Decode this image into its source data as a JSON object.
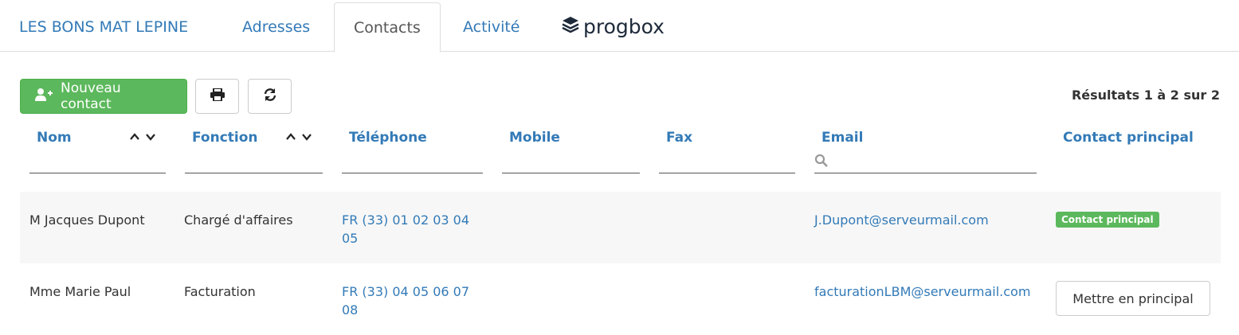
{
  "tabs": {
    "company": "LES BONS MAT LEPINE",
    "addresses": "Adresses",
    "contacts": "Contacts",
    "activity": "Activité"
  },
  "logo": {
    "text": "progbox"
  },
  "toolbar": {
    "new_contact_label": "Nouveau contact",
    "results_text": "Résultats 1 à 2 sur 2"
  },
  "columns": {
    "name": "Nom",
    "function": "Fonction",
    "phone": "Téléphone",
    "mobile": "Mobile",
    "fax": "Fax",
    "email": "Email",
    "primary": "Contact principal"
  },
  "filters": {
    "name": "",
    "function": "",
    "phone": "",
    "mobile": "",
    "fax": "",
    "email": ""
  },
  "rows": [
    {
      "name": "M Jacques Dupont",
      "function": "Chargé d'affaires",
      "phone": "FR (33) 01 02 03 04 05",
      "mobile": "",
      "fax": "",
      "email": "J.Dupont@serveurmail.com",
      "primary_badge": "Contact principal"
    },
    {
      "name": "Mme Marie Paul",
      "function": "Facturation",
      "phone": "FR (33) 04 05 06 07 08",
      "mobile": "",
      "fax": "",
      "email": "facturationLBM@serveurmail.com",
      "primary_button": "Mettre en principal"
    }
  ],
  "colors": {
    "link": "#337ab7",
    "success": "#5cb85c",
    "row_stripe": "#f7f7f7"
  }
}
